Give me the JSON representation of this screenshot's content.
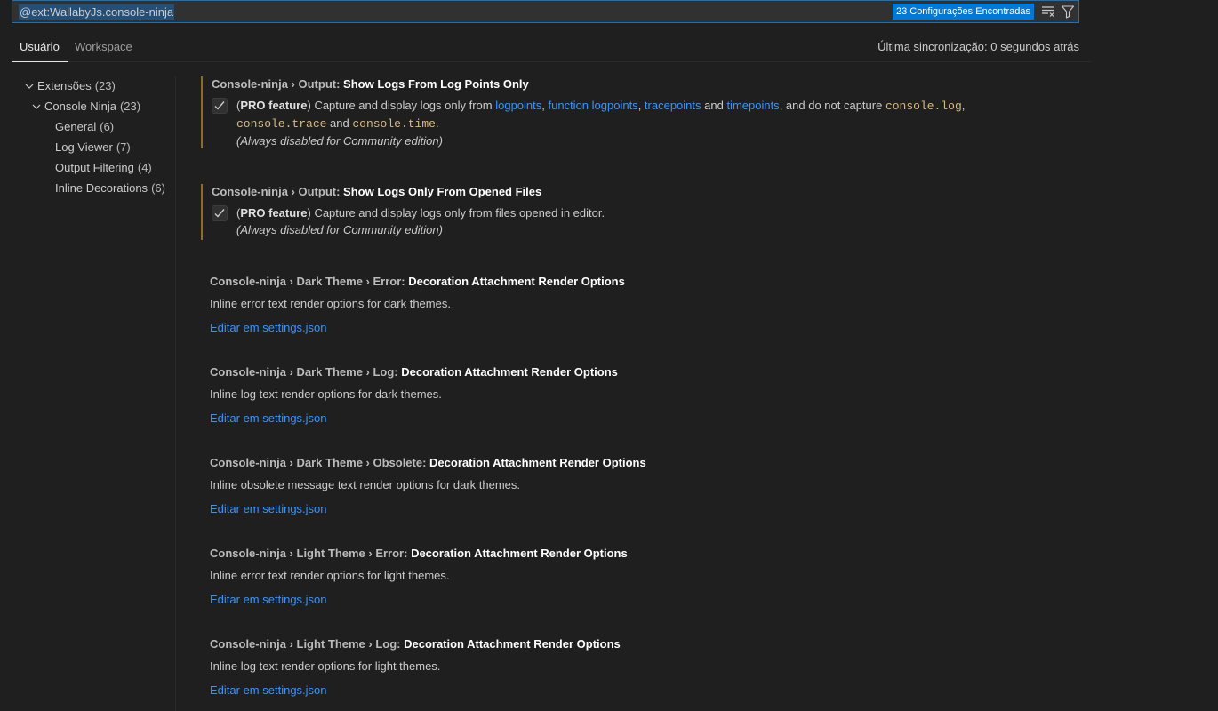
{
  "search": {
    "query": "@ext:WallabyJs.console-ninja",
    "results_badge": "23 Configurações Encontradas"
  },
  "tabs": {
    "user": "Usuário",
    "workspace": "Workspace",
    "active": "user"
  },
  "sync_status": "Última sincronização: 0 segundos atrás",
  "toc": {
    "items": [
      {
        "label": "Extensões",
        "count": "(23)",
        "expanded": true
      },
      {
        "label": "Console Ninja",
        "count": "(23)",
        "expanded": true
      },
      {
        "label": "General",
        "count": "(6)"
      },
      {
        "label": "Log Viewer",
        "count": "(7)"
      },
      {
        "label": "Output Filtering",
        "count": "(4)"
      },
      {
        "label": "Inline Decorations",
        "count": "(6)"
      }
    ]
  },
  "settings": [
    {
      "category": "Console-ninja › Output: ",
      "label": "Show Logs From Log Points Only",
      "checked": true,
      "modified": true,
      "pro_open": "(",
      "pro_label": "PRO feature",
      "pro_close": ")",
      "desc_1": " Capture and display logs only from ",
      "link_1": "logpoints",
      "sep_1": ", ",
      "link_2": "function logpoints",
      "sep_2": ", ",
      "link_3": "tracepoints",
      "sep_3": " and ",
      "link_4": "timepoints",
      "desc_2": ", and do not capture ",
      "code_1": "console.log",
      "sep_4": ",",
      "code_2": "console.trace",
      "sep_5": " and ",
      "code_3": "console.time",
      "sep_6": ".",
      "note": "(Always disabled for Community edition)"
    },
    {
      "category": "Console-ninja › Output: ",
      "label": "Show Logs Only From Opened Files",
      "checked": true,
      "modified": true,
      "pro_open": "(",
      "pro_label": "PRO feature",
      "pro_close": ")",
      "desc": " Capture and display logs only from files opened in editor.",
      "note": "(Always disabled for Community edition)"
    },
    {
      "category": "Console-ninja › Dark Theme › Error: ",
      "label": "Decoration Attachment Render Options",
      "desc": "Inline error text render options for dark themes.",
      "edit_link": "Editar em settings.json"
    },
    {
      "category": "Console-ninja › Dark Theme › Log: ",
      "label": "Decoration Attachment Render Options",
      "desc": "Inline log text render options for dark themes.",
      "edit_link": "Editar em settings.json"
    },
    {
      "category": "Console-ninja › Dark Theme › Obsolete: ",
      "label": "Decoration Attachment Render Options",
      "desc": "Inline obsolete message text render options for dark themes.",
      "edit_link": "Editar em settings.json"
    },
    {
      "category": "Console-ninja › Light Theme › Error: ",
      "label": "Decoration Attachment Render Options",
      "desc": "Inline error text render options for light themes.",
      "edit_link": "Editar em settings.json"
    },
    {
      "category": "Console-ninja › Light Theme › Log: ",
      "label": "Decoration Attachment Render Options",
      "desc": "Inline log text render options for light themes.",
      "edit_link": "Editar em settings.json"
    }
  ],
  "colors": {
    "accent": "#0078d4",
    "link": "#3794ff",
    "code": "#d7ba7d",
    "modified_marker": "#8a6d2c"
  },
  "icons": {
    "clear_filter": "clear-all-icon",
    "filter": "filter-icon",
    "chevron": "chevron-down-icon",
    "check": "check-icon"
  }
}
